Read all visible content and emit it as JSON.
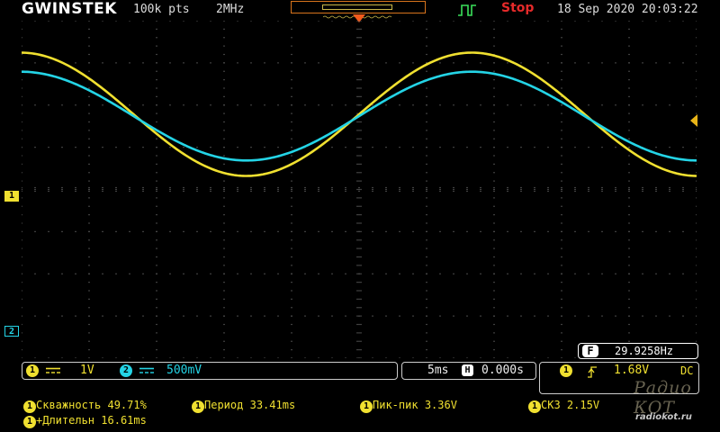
{
  "topbar": {
    "brand": "GWINSTEK",
    "record_length": "100k pts",
    "sample_rate": "2MHz",
    "acquire_mode_icon": "edge-trigger-icon",
    "run_status": "Stop",
    "datetime": "18 Sep 2020 20:03:22"
  },
  "colors": {
    "ch1": "#f0e030",
    "ch2": "#24d4e6",
    "stop": "#e52a2a",
    "grid": "#6b6b6b",
    "memory_window": "#d8741c"
  },
  "markers": {
    "ch1": "1",
    "ch2": "2"
  },
  "frequency_counter": {
    "badge": "F",
    "value": "29.9258Hz"
  },
  "channels": {
    "ch1": {
      "badge": "1",
      "scale": "1V"
    },
    "ch2": {
      "badge": "2",
      "scale": "500mV"
    }
  },
  "timebase": {
    "scale": "5ms",
    "h_badge": "H",
    "position": "0.000s"
  },
  "trigger": {
    "source_badge": "1",
    "slope_icon": "rising-edge-icon",
    "level": "1.68V",
    "coupling": "DC"
  },
  "measurements": [
    {
      "badge": "1",
      "label": "Скважность",
      "value": "49.71%"
    },
    {
      "badge": "1",
      "label": "Период",
      "value": "33.41ms"
    },
    {
      "badge": "1",
      "label": "Пик-пик",
      "value": "3.36V"
    },
    {
      "badge": "1",
      "label": "СКЗ",
      "value": "2.15V"
    },
    {
      "badge": "1",
      "label": "+Длительн",
      "value": "16.61ms"
    }
  ],
  "watermark": {
    "logo_text": "Радио КОТ",
    "site": "radiokot.ru"
  },
  "waveforms": {
    "ch1": {
      "frequency_hz": 29.9258,
      "peak_to_peak_v": 3.36,
      "volts_per_div": 1
    },
    "ch2": {
      "volts_per_div": 0.5
    },
    "time_per_div_ms": 5
  }
}
